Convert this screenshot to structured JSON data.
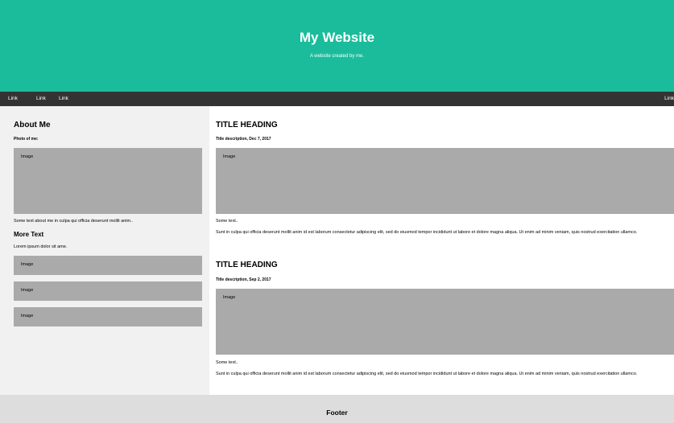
{
  "header": {
    "title": "My Website",
    "subtitle": "A website created by me."
  },
  "navbar": {
    "links": [
      "Link",
      "Link",
      "Link"
    ],
    "right_link": "Link"
  },
  "sidebar": {
    "heading": "About Me",
    "photo_label": "Photo of me:",
    "image_label": "Image",
    "about_text": "Some text about me in culpa qui officia deserunt mollit anim..",
    "more_heading": "More Text",
    "more_text": "Lorem ipsum dolor sit ame.",
    "small_images": [
      "Image",
      "Image",
      "Image"
    ]
  },
  "main": {
    "posts": [
      {
        "title": "TITLE HEADING",
        "description": "Title description, Dec 7, 2017",
        "image_label": "Image",
        "some_text": "Some text..",
        "body": "Sunt in culpa qui officia deserunt mollit anim id est laborum consectetur adipiscing elit, sed do eiusmod tempor incididunt ut labore et dolore magna aliqua. Ut enim ad minim veniam, quis nostrud exercitation ullamco."
      },
      {
        "title": "TITLE HEADING",
        "description": "Title description, Sep 2, 2017",
        "image_label": "Image",
        "some_text": "Some text..",
        "body": "Sunt in culpa qui officia deserunt mollit anim id est laborum consectetur adipiscing elit, sed do eiusmod tempor incididunt ut labore et dolore magna aliqua. Ut enim ad minim veniam, quis nostrud exercitation ullamco."
      }
    ]
  },
  "footer": {
    "label": "Footer"
  },
  "colors": {
    "header_bg": "#1abc9c",
    "navbar_bg": "#333333",
    "sidebar_bg": "#f1f1f1",
    "image_placeholder": "#aaaaaa",
    "footer_bg": "#dddddd"
  }
}
